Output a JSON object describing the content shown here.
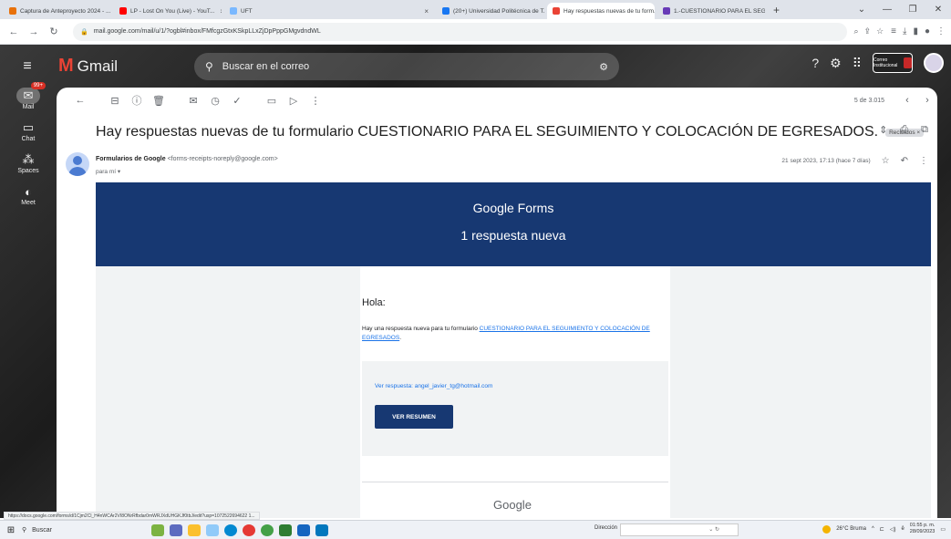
{
  "browser": {
    "tabs": [
      {
        "label": "Captura de Anteproyecto 2024 - ...",
        "color": "#e8710a",
        "active": false
      },
      {
        "label": "LP - Lost On You (Live) - YouT...",
        "color": "#ff0000",
        "active": false
      },
      {
        "label": "UFT",
        "color": "#7ab8ff",
        "active": false
      },
      {
        "label": "(20+) Universidad Politécnica de T...",
        "color": "#1877f2",
        "active": false
      },
      {
        "label": "Hay respuestas nuevas de tu form...",
        "color": "#ea4335",
        "active": true
      },
      {
        "label": "1.-CUESTIONARIO PARA EL SEGUIM...",
        "color": "#673ab7",
        "active": false
      }
    ],
    "new_tab": "+",
    "url": "mail.google.com/mail/u/1/?ogbl#inbox/FMfcgzGtxKSkpLLxZjDpPppGMgvdndWL",
    "status_url": "https://docs.google.com/forms/d/1Cjm2Cl_H4nWCAr2VI8ONrRfbdar0mWRJXdUHGKJf0tbJ/edit?usp=1072522694622 1..."
  },
  "gmail": {
    "app_name": "Gmail",
    "search_placeholder": "Buscar en el correo",
    "account_badge": "Correo Institucional",
    "rail": [
      {
        "label": "Mail",
        "badge": "99+"
      },
      {
        "label": "Chat"
      },
      {
        "label": "Spaces"
      },
      {
        "label": "Meet"
      }
    ],
    "pagination": "5 de 3.015"
  },
  "email": {
    "subject": "Hay respuestas nuevas de tu formulario CUESTIONARIO PARA EL SEGUIMIENTO Y COLOCACIÓN DE EGRESADOS.",
    "label": "Recibidos ×",
    "sender_name": "Formularios de Google",
    "sender_email": "<forms-receipts-noreply@google.com>",
    "to": "para mí ▾",
    "date": "21 sept 2023, 17:13 (hace 7 días)",
    "banner_brand_bold": "Google",
    "banner_brand_rest": " Forms",
    "banner_new": "1 respuesta nueva",
    "greeting": "Hola:",
    "intro_text": "Hay una respuesta nueva para tu formulario ",
    "form_link": "CUESTIONARIO PARA EL SEGUIMIENTO Y COLOCACIÓN DE EGRESADOS",
    "intro_end": ".",
    "response_link": "Ver respuesta: angel_javier_tg@hotmail.com",
    "button": "VER RESUMEN",
    "footer_logo": "Google"
  },
  "taskbar": {
    "search": "Buscar",
    "address_label": "Dirección",
    "weather": "26°C Bruma",
    "time": "01:55 p. m.",
    "date": "28/09/2023"
  }
}
